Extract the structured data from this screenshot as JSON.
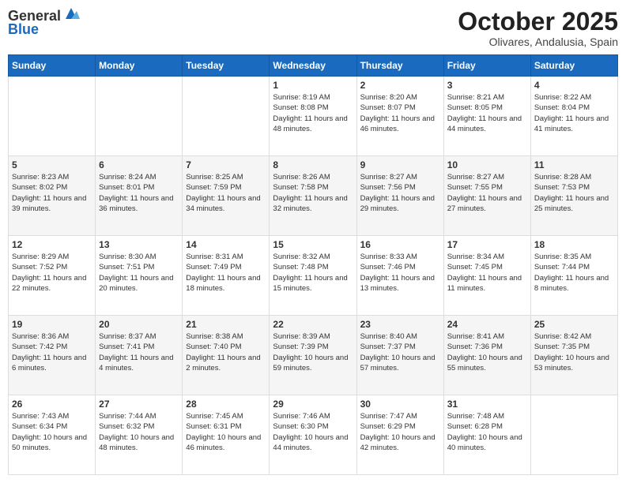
{
  "header": {
    "logo_line1": "General",
    "logo_line2": "Blue",
    "month": "October 2025",
    "location": "Olivares, Andalusia, Spain"
  },
  "days_of_week": [
    "Sunday",
    "Monday",
    "Tuesday",
    "Wednesday",
    "Thursday",
    "Friday",
    "Saturday"
  ],
  "weeks": [
    [
      {
        "day": "",
        "info": ""
      },
      {
        "day": "",
        "info": ""
      },
      {
        "day": "",
        "info": ""
      },
      {
        "day": "1",
        "info": "Sunrise: 8:19 AM\nSunset: 8:08 PM\nDaylight: 11 hours and 48 minutes."
      },
      {
        "day": "2",
        "info": "Sunrise: 8:20 AM\nSunset: 8:07 PM\nDaylight: 11 hours and 46 minutes."
      },
      {
        "day": "3",
        "info": "Sunrise: 8:21 AM\nSunset: 8:05 PM\nDaylight: 11 hours and 44 minutes."
      },
      {
        "day": "4",
        "info": "Sunrise: 8:22 AM\nSunset: 8:04 PM\nDaylight: 11 hours and 41 minutes."
      }
    ],
    [
      {
        "day": "5",
        "info": "Sunrise: 8:23 AM\nSunset: 8:02 PM\nDaylight: 11 hours and 39 minutes."
      },
      {
        "day": "6",
        "info": "Sunrise: 8:24 AM\nSunset: 8:01 PM\nDaylight: 11 hours and 36 minutes."
      },
      {
        "day": "7",
        "info": "Sunrise: 8:25 AM\nSunset: 7:59 PM\nDaylight: 11 hours and 34 minutes."
      },
      {
        "day": "8",
        "info": "Sunrise: 8:26 AM\nSunset: 7:58 PM\nDaylight: 11 hours and 32 minutes."
      },
      {
        "day": "9",
        "info": "Sunrise: 8:27 AM\nSunset: 7:56 PM\nDaylight: 11 hours and 29 minutes."
      },
      {
        "day": "10",
        "info": "Sunrise: 8:27 AM\nSunset: 7:55 PM\nDaylight: 11 hours and 27 minutes."
      },
      {
        "day": "11",
        "info": "Sunrise: 8:28 AM\nSunset: 7:53 PM\nDaylight: 11 hours and 25 minutes."
      }
    ],
    [
      {
        "day": "12",
        "info": "Sunrise: 8:29 AM\nSunset: 7:52 PM\nDaylight: 11 hours and 22 minutes."
      },
      {
        "day": "13",
        "info": "Sunrise: 8:30 AM\nSunset: 7:51 PM\nDaylight: 11 hours and 20 minutes."
      },
      {
        "day": "14",
        "info": "Sunrise: 8:31 AM\nSunset: 7:49 PM\nDaylight: 11 hours and 18 minutes."
      },
      {
        "day": "15",
        "info": "Sunrise: 8:32 AM\nSunset: 7:48 PM\nDaylight: 11 hours and 15 minutes."
      },
      {
        "day": "16",
        "info": "Sunrise: 8:33 AM\nSunset: 7:46 PM\nDaylight: 11 hours and 13 minutes."
      },
      {
        "day": "17",
        "info": "Sunrise: 8:34 AM\nSunset: 7:45 PM\nDaylight: 11 hours and 11 minutes."
      },
      {
        "day": "18",
        "info": "Sunrise: 8:35 AM\nSunset: 7:44 PM\nDaylight: 11 hours and 8 minutes."
      }
    ],
    [
      {
        "day": "19",
        "info": "Sunrise: 8:36 AM\nSunset: 7:42 PM\nDaylight: 11 hours and 6 minutes."
      },
      {
        "day": "20",
        "info": "Sunrise: 8:37 AM\nSunset: 7:41 PM\nDaylight: 11 hours and 4 minutes."
      },
      {
        "day": "21",
        "info": "Sunrise: 8:38 AM\nSunset: 7:40 PM\nDaylight: 11 hours and 2 minutes."
      },
      {
        "day": "22",
        "info": "Sunrise: 8:39 AM\nSunset: 7:39 PM\nDaylight: 10 hours and 59 minutes."
      },
      {
        "day": "23",
        "info": "Sunrise: 8:40 AM\nSunset: 7:37 PM\nDaylight: 10 hours and 57 minutes."
      },
      {
        "day": "24",
        "info": "Sunrise: 8:41 AM\nSunset: 7:36 PM\nDaylight: 10 hours and 55 minutes."
      },
      {
        "day": "25",
        "info": "Sunrise: 8:42 AM\nSunset: 7:35 PM\nDaylight: 10 hours and 53 minutes."
      }
    ],
    [
      {
        "day": "26",
        "info": "Sunrise: 7:43 AM\nSunset: 6:34 PM\nDaylight: 10 hours and 50 minutes."
      },
      {
        "day": "27",
        "info": "Sunrise: 7:44 AM\nSunset: 6:32 PM\nDaylight: 10 hours and 48 minutes."
      },
      {
        "day": "28",
        "info": "Sunrise: 7:45 AM\nSunset: 6:31 PM\nDaylight: 10 hours and 46 minutes."
      },
      {
        "day": "29",
        "info": "Sunrise: 7:46 AM\nSunset: 6:30 PM\nDaylight: 10 hours and 44 minutes."
      },
      {
        "day": "30",
        "info": "Sunrise: 7:47 AM\nSunset: 6:29 PM\nDaylight: 10 hours and 42 minutes."
      },
      {
        "day": "31",
        "info": "Sunrise: 7:48 AM\nSunset: 6:28 PM\nDaylight: 10 hours and 40 minutes."
      },
      {
        "day": "",
        "info": ""
      }
    ]
  ]
}
